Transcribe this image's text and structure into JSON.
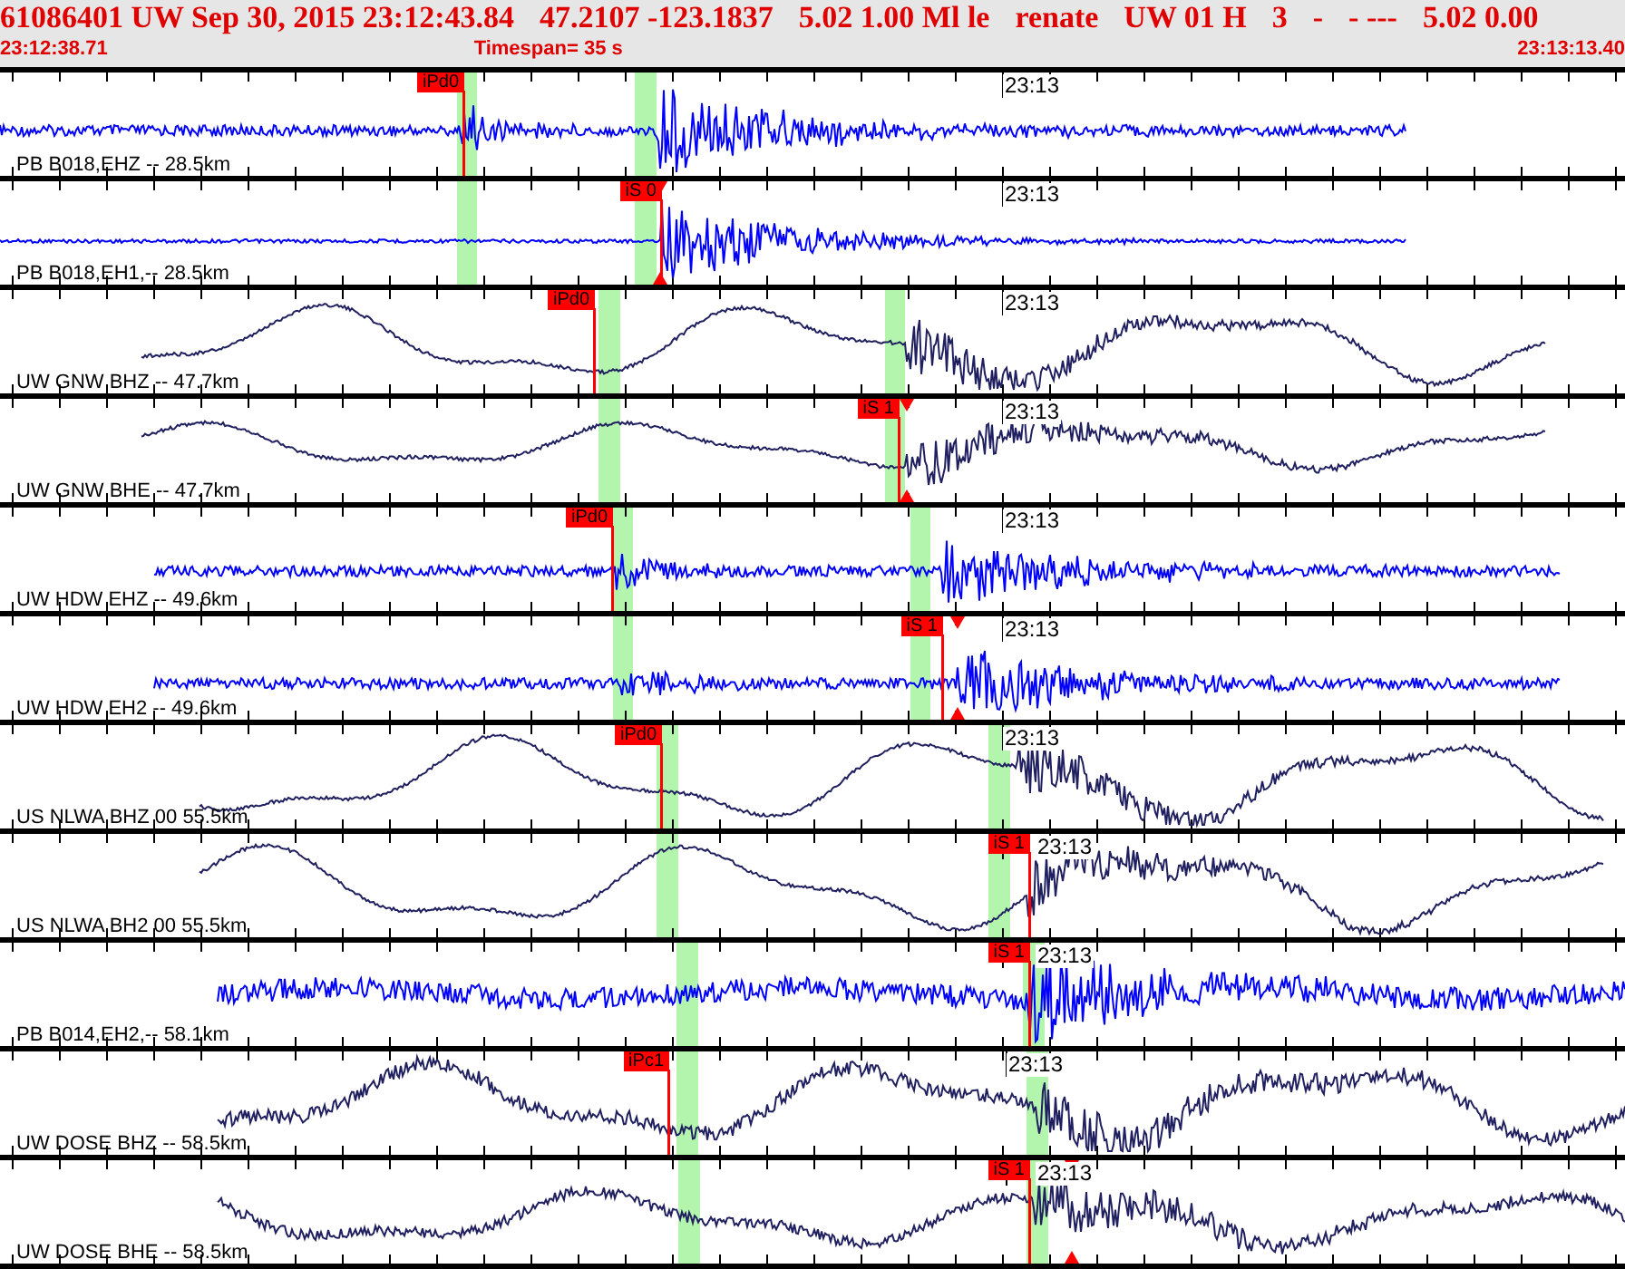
{
  "header": {
    "event_fields": [
      "61086401 UW Sep 30, 2015 23:12:43.84",
      "47.2107 -123.1837",
      "5.02 1.00 Ml le",
      "renate",
      "UW 01 H",
      "3",
      "-",
      "- ---",
      "5.02 0.00"
    ],
    "start_time": "23:12:38.71",
    "timespan": "Timespan=  35 s",
    "end_time": "23:13:13.40"
  },
  "traces": [
    {
      "label": "PB B018,EHZ -- 28.5km",
      "time_label": "23:13",
      "color": "#0000ff",
      "pick": {
        "label": "iPd0"
      }
    },
    {
      "label": "PB B018,EH1,-- 28.5km",
      "time_label": "23:13",
      "color": "#0000ff",
      "pick": {
        "label": "iS 0"
      }
    },
    {
      "label": "UW GNW BHZ -- 47.7km",
      "time_label": "23:13",
      "color": "#202060",
      "pick": {
        "label": "iPd0"
      }
    },
    {
      "label": "UW GNW BHE -- 47.7km",
      "time_label": "23:13",
      "color": "#202060",
      "pick": {
        "label": "iS 1"
      }
    },
    {
      "label": "UW HDW EHZ -- 49.6km",
      "time_label": "23:13",
      "color": "#0000ff",
      "pick": {
        "label": "iPd0"
      }
    },
    {
      "label": "UW HDW EH2 -- 49.6km",
      "time_label": "23:13",
      "color": "#0000ff",
      "pick": {
        "label": "iS 1"
      }
    },
    {
      "label": "US NLWA BHZ 00 55.5km",
      "time_label": "23:13",
      "color": "#202060",
      "pick": {
        "label": "iPd0"
      }
    },
    {
      "label": "US NLWA BH2 00 55.5km",
      "time_label": "23:13",
      "color": "#202060",
      "pick": {
        "label": "iS 1"
      }
    },
    {
      "label": "PB B014,EH2,-- 58.1km",
      "time_label": "23:13",
      "color": "#0000ff",
      "pick": {
        "label": "iS 1"
      }
    },
    {
      "label": "UW DOSE BHZ -- 58.5km",
      "time_label": "23:13",
      "color": "#202060",
      "pick": {
        "label": "iPc1"
      }
    },
    {
      "label": "UW DOSE BHE -- 58.5km",
      "time_label": "23:13",
      "color": "#202060",
      "pick": {
        "label": "iS 1"
      }
    }
  ]
}
